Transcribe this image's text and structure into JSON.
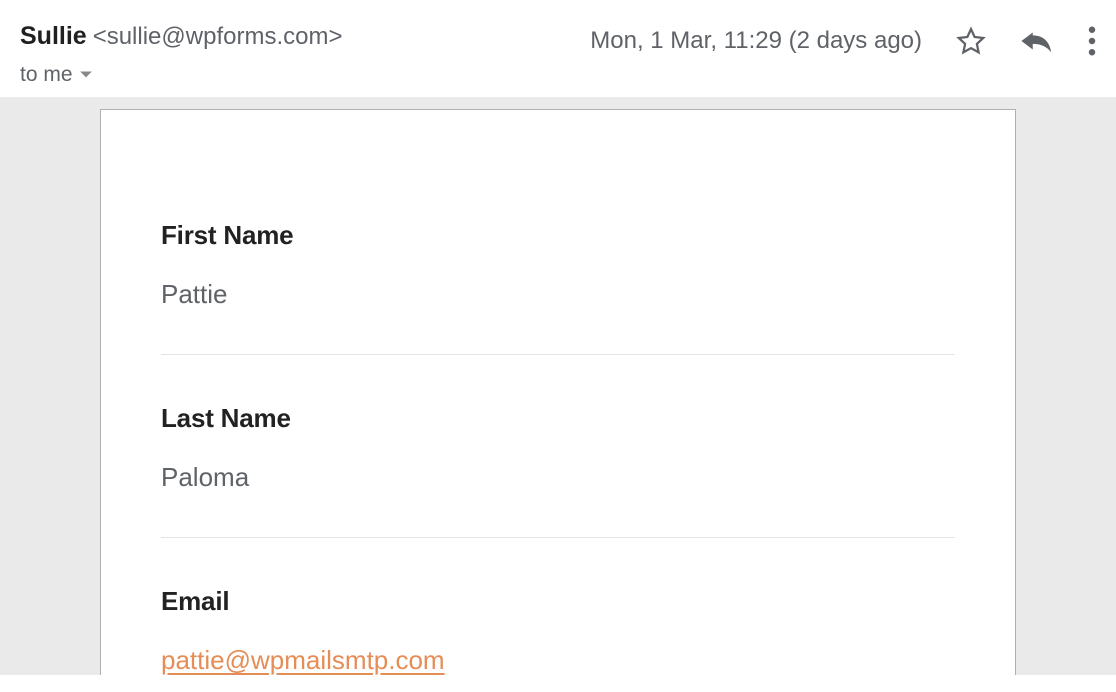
{
  "header": {
    "sender_name": "Sullie",
    "sender_email": "<sullie@wpforms.com>",
    "to_label": "to me",
    "date": "Mon, 1 Mar, 11:29 (2 days ago)"
  },
  "body": {
    "fields": [
      {
        "label": "First Name",
        "value": "Pattie",
        "is_link": false
      },
      {
        "label": "Last Name",
        "value": "Paloma",
        "is_link": false
      },
      {
        "label": "Email",
        "value": "pattie@wpmailsmtp.com",
        "is_link": true
      }
    ]
  },
  "colors": {
    "link_orange": "#e58d56",
    "muted_text": "#5f6368",
    "body_bg": "#eaeaea",
    "card_border": "#b0b0b0"
  }
}
